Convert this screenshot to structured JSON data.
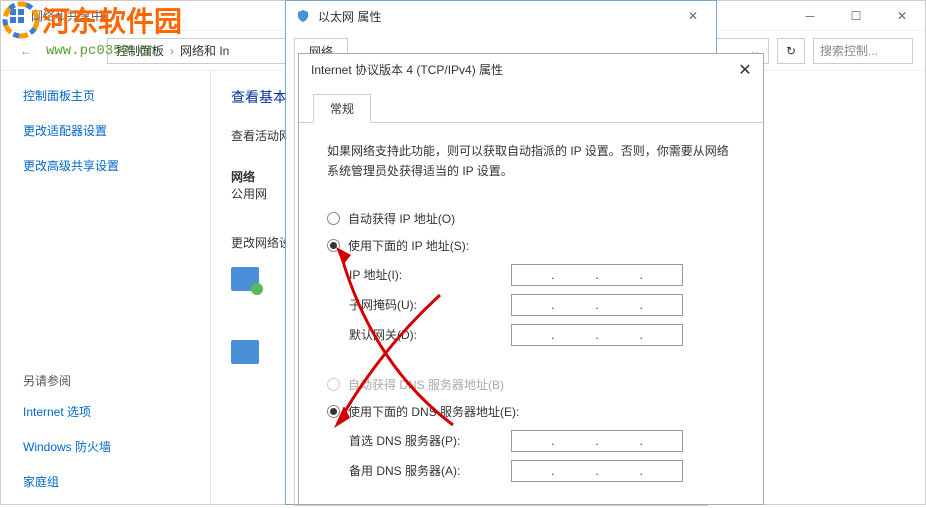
{
  "bg": {
    "title": "网络和共享中心",
    "breadcrumb": {
      "root": "控制面板",
      "current": "网络和 In",
      "chevrons": "›"
    },
    "search_placeholder": "搜索控制...",
    "sidebar": {
      "home": "控制面板主页",
      "adapter": "更改适配器设置",
      "sharing": "更改高级共享设置",
      "seealso": "另请参阅",
      "internet": "Internet 选项",
      "firewall": "Windows 防火墙",
      "homegroup": "家庭组"
    },
    "main": {
      "heading": "查看基本",
      "active": "查看活动网",
      "net_label": "网络",
      "public": "公用网",
      "change": "更改网络设"
    }
  },
  "dlg1": {
    "title": "以太网 属性",
    "tab": "网络"
  },
  "dlg2": {
    "title": "Internet 协议版本 4 (TCP/IPv4) 属性",
    "tab": "常规",
    "description": "如果网络支持此功能，则可以获取自动指派的 IP 设置。否则，你需要从网络系统管理员处获得适当的 IP 设置。",
    "radio_auto_ip": "自动获得 IP 地址(O)",
    "radio_static_ip": "使用下面的 IP 地址(S):",
    "ip_addr": "IP 地址(I):",
    "subnet": "子网掩码(U):",
    "gateway": "默认网关(D):",
    "radio_auto_dns": "自动获得 DNS 服务器地址(B)",
    "radio_static_dns": "使用下面的 DNS 服务器地址(E):",
    "dns1": "首选 DNS 服务器(P):",
    "dns2": "备用 DNS 服务器(A):"
  },
  "watermark": {
    "text": "河东软件园",
    "url": "www.pc0359.cn"
  }
}
